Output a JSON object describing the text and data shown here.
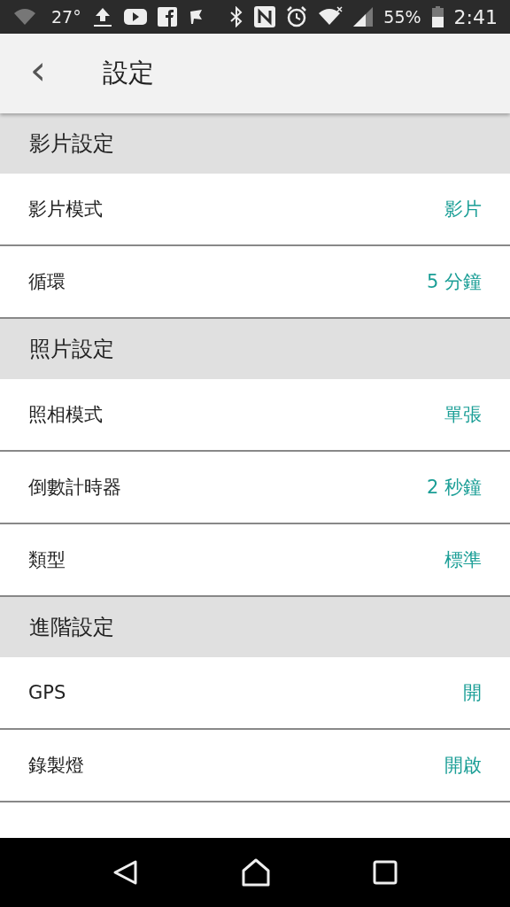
{
  "status_bar": {
    "temperature": "27°",
    "battery_percent": "55%",
    "time": "2:41"
  },
  "app_bar": {
    "back": "‹",
    "title": "設定"
  },
  "sections": [
    {
      "title": "影片設定",
      "rows": [
        {
          "label": "影片模式",
          "value": "影片"
        },
        {
          "label": "循環",
          "value": "5 分鐘"
        }
      ]
    },
    {
      "title": "照片設定",
      "rows": [
        {
          "label": "照相模式",
          "value": "單張"
        },
        {
          "label": "倒數計時器",
          "value": "2 秒鐘"
        },
        {
          "label": "類型",
          "value": "標準"
        }
      ]
    },
    {
      "title": "進階設定",
      "rows": [
        {
          "label": "GPS",
          "value": "開"
        },
        {
          "label": "錄製燈",
          "value": "開啟"
        }
      ]
    }
  ]
}
